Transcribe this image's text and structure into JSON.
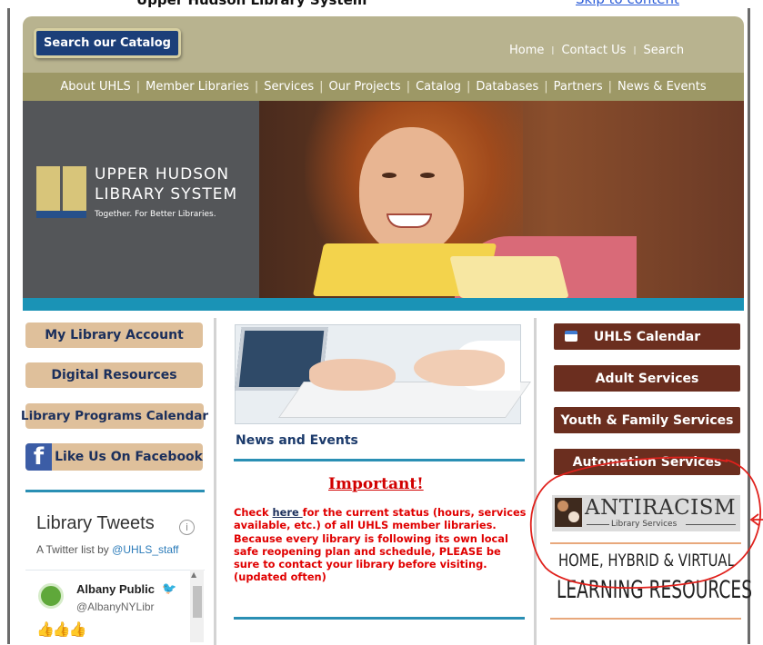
{
  "top_strip": {
    "cut_text": "Upper Hudson Library System",
    "cut_link": "Skip to content"
  },
  "header": {
    "catalog_button": "Search our Catalog",
    "links": [
      "Home",
      "Contact Us",
      "Search"
    ]
  },
  "nav": {
    "items": [
      "About UHLS",
      "Member Libraries",
      "Services",
      "Our Projects",
      "Catalog",
      "Databases",
      "Partners",
      "News & Events"
    ]
  },
  "banner": {
    "title_line1": "UPPER HUDSON",
    "title_line2": "LIBRARY SYSTEM",
    "tagline": "Together. For Better Libraries."
  },
  "left": {
    "buttons": [
      "My Library Account",
      "Digital Resources",
      "Library Programs Calendar"
    ],
    "facebook_label": "Like Us On Facebook",
    "facebook_icon": "f",
    "tweets_title": "Library Tweets",
    "tweets_sub_prefix": "A Twitter list by ",
    "tweets_sub_handle": "@UHLS_staff",
    "tweet_name": "Albany Public",
    "tweet_handle": "@AlbanyNYLibr",
    "tweet_emoji": "👍👍👍"
  },
  "middle": {
    "news_title": "News and Events",
    "important": "Important!",
    "notice_prefix": "Check ",
    "notice_link": "here ",
    "notice_rest": "for the current status (hours, services available, etc.) of all UHLS member libraries. Because every library is following its own local safe reopening plan and schedule, PLEASE be sure to contact your library before visiting. (updated often)"
  },
  "right": {
    "buttons": [
      "UHLS Calendar",
      "Adult Services",
      "Youth & Family Services",
      "Automation Services"
    ],
    "antiracism_title": "ANTIRACISM",
    "antiracism_sub": "Library Services",
    "home_hybrid_line1": "HOME, HYBRID & VIRTUAL",
    "home_hybrid_line2": "LEARNING RESOURCES"
  },
  "colors": {
    "header_bg": "#b8b38f",
    "nav_bg": "#9d9866",
    "accent_blue": "#1a93b6",
    "left_button_bg": "#dfc09b",
    "right_button_bg": "#6b2e1f",
    "alert_red": "#e00000",
    "annotation_red": "#e0211c"
  },
  "icons": [
    "info-icon",
    "facebook-icon",
    "twitter-bird-icon",
    "calendar-icon",
    "scroll-up-arrow-icon"
  ]
}
